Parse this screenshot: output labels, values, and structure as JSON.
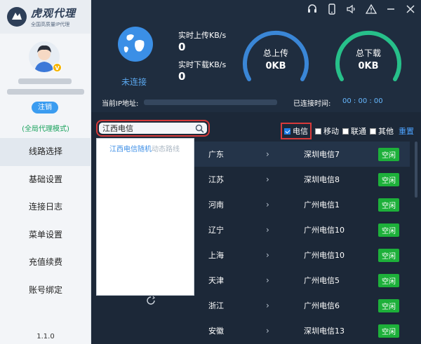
{
  "app": {
    "title": "虎观代理",
    "subtitle": "全国高质量IP代理",
    "version": "1.1.0"
  },
  "user": {
    "vip_badge": "V",
    "logout_label": "注销",
    "mode_text": "(全局代理模式)"
  },
  "sidebar": {
    "items": [
      {
        "label": "线路选择",
        "active": true
      },
      {
        "label": "基础设置",
        "active": false
      },
      {
        "label": "连接日志",
        "active": false
      },
      {
        "label": "菜单设置",
        "active": false
      },
      {
        "label": "充值续费",
        "active": false
      },
      {
        "label": "账号绑定",
        "active": false
      }
    ]
  },
  "header": {
    "status": "未连接",
    "upload_label": "实时上传KB/s",
    "upload_value": "0",
    "download_label": "实时下载KB/s",
    "download_value": "0",
    "total_upload_label": "总上传",
    "total_upload_value": "0KB",
    "total_download_label": "总下载",
    "total_download_value": "0KB",
    "ip_label": "当前IP地址:",
    "connected_time_label": "已连接时间:",
    "connected_time_value": "00 : 00 : 00",
    "icons": [
      "headset-icon",
      "phone-icon",
      "speaker-icon",
      "alert-icon",
      "minimize-icon",
      "close-icon"
    ]
  },
  "colors": {
    "upload_gauge": "#3a86d6",
    "download_gauge": "#27c08a",
    "status_free": "#1db03a",
    "highlight": "#d83a3a"
  },
  "search": {
    "value": "江西电信",
    "dropdown": [
      {
        "main": "江西电信随机",
        "sub": "动态路线"
      }
    ]
  },
  "filters": {
    "telecom": {
      "label": "电信",
      "checked": true
    },
    "mobile": {
      "label": "移动",
      "checked": false
    },
    "unicom": {
      "label": "联通",
      "checked": false
    },
    "other": {
      "label": "其他",
      "checked": false
    },
    "reset_label": "重置"
  },
  "lines": [
    {
      "province": "广东",
      "server": "深圳电信7",
      "status": "空闲"
    },
    {
      "province": "江苏",
      "server": "深圳电信8",
      "status": "空闲"
    },
    {
      "province": "河南",
      "server": "广州电信1",
      "status": "空闲"
    },
    {
      "province": "辽宁",
      "server": "广州电信10",
      "status": "空闲"
    },
    {
      "province": "上海",
      "server": "广州电信10",
      "status": "空闲"
    },
    {
      "province": "天津",
      "server": "广州电信5",
      "status": "空闲"
    },
    {
      "province": "浙江",
      "server": "广州电信6",
      "status": "空闲"
    },
    {
      "province": "安徽",
      "server": "深圳电信13",
      "status": "空闲"
    }
  ]
}
